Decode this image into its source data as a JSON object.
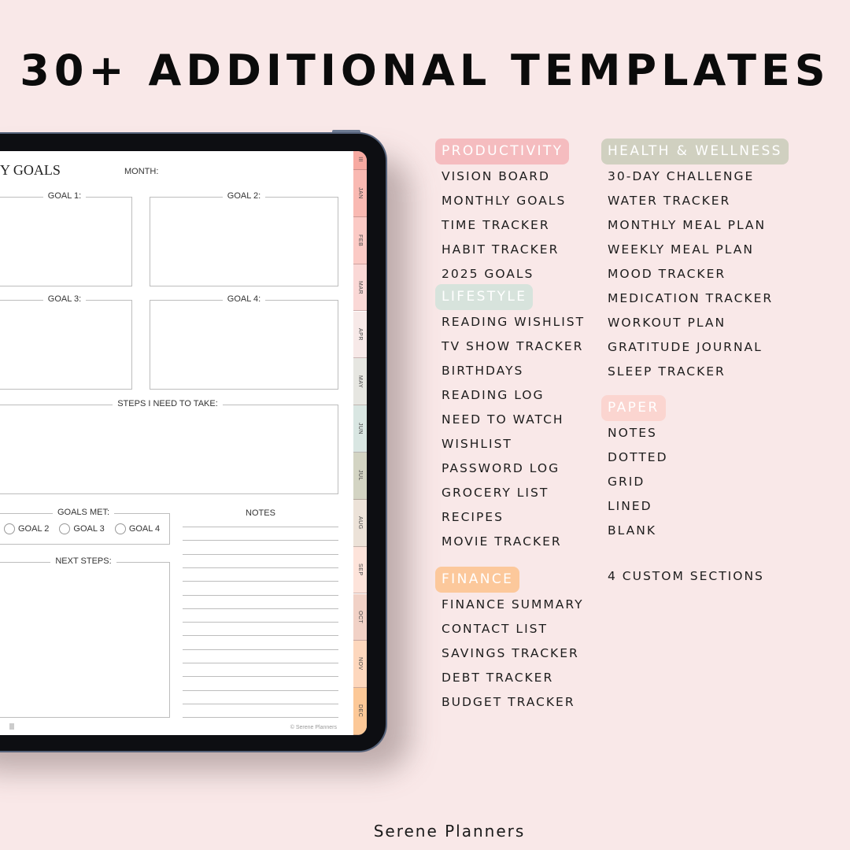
{
  "headline": "30+ ADDITIONAL TEMPLATES",
  "footer": "Serene Planners",
  "planner_page": {
    "title": "Y GOALS",
    "month_label": "MONTH:",
    "goal_boxes": [
      "GOAL 1:",
      "GOAL 2:",
      "GOAL 3:",
      "GOAL 4:"
    ],
    "steps_label": "STEPS I NEED TO TAKE:",
    "goals_met_label": "GOALS MET:",
    "goals_met_options": [
      "GOAL 2",
      "GOAL 3",
      "GOAL 4"
    ],
    "next_steps_label": "NEXT STEPS:",
    "notes_label": "NOTES",
    "copyright": "© Serene Planners",
    "tabs": [
      {
        "label": "JAN",
        "color": "#f9b9b2"
      },
      {
        "label": "FEB",
        "color": "#fbcac5"
      },
      {
        "label": "MAR",
        "color": "#fad8d6"
      },
      {
        "label": "APR",
        "color": "#f7e9e8"
      },
      {
        "label": "MAY",
        "color": "#e6e6e1"
      },
      {
        "label": "JUN",
        "color": "#d9e6e2"
      },
      {
        "label": "JUL",
        "color": "#d3d4c3"
      },
      {
        "label": "AUG",
        "color": "#ece2d8"
      },
      {
        "label": "SEP",
        "color": "#fde3da"
      },
      {
        "label": "OCT",
        "color": "#f1d1c6"
      },
      {
        "label": "NOV",
        "color": "#fdd7bd"
      },
      {
        "label": "DEC",
        "color": "#fcc897"
      }
    ],
    "menu_tab_color": "#f7a9a1"
  },
  "categories": {
    "productivity": {
      "label": "PRODUCTIVITY",
      "color": "#f5bcbf",
      "items": [
        "VISION BOARD",
        "MONTHLY GOALS",
        "TIME TRACKER",
        "HABIT TRACKER",
        "2025 GOALS"
      ]
    },
    "lifestyle": {
      "label": "LIFESTYLE",
      "color": "#d7e3dc",
      "items": [
        "READING WISHLIST",
        "TV SHOW TRACKER",
        "BIRTHDAYS",
        "READING LOG",
        "NEED TO WATCH",
        "WISHLIST",
        "PASSWORD LOG",
        "GROCERY LIST",
        "RECIPES",
        "MOVIE TRACKER"
      ]
    },
    "finance": {
      "label": "FINANCE",
      "color": "#fcc89b",
      "items": [
        "FINANCE SUMMARY",
        "CONTACT LIST",
        "SAVINGS TRACKER",
        "DEBT TRACKER",
        "BUDGET TRACKER"
      ]
    },
    "health": {
      "label": "HEALTH & WELLNESS",
      "color": "#d0d0c0",
      "items": [
        "30-DAY CHALLENGE",
        "WATER TRACKER",
        "MONTHLY MEAL PLAN",
        "WEEKLY MEAL PLAN",
        "MOOD TRACKER",
        "MEDICATION TRACKER",
        "WORKOUT PLAN",
        "GRATITUDE JOURNAL",
        "SLEEP TRACKER"
      ]
    },
    "paper": {
      "label": "PAPER",
      "color": "#fbd5d0",
      "items": [
        "NOTES",
        "DOTTED",
        "GRID",
        "LINED",
        "BLANK"
      ]
    },
    "extra": "4 CUSTOM SECTIONS"
  }
}
